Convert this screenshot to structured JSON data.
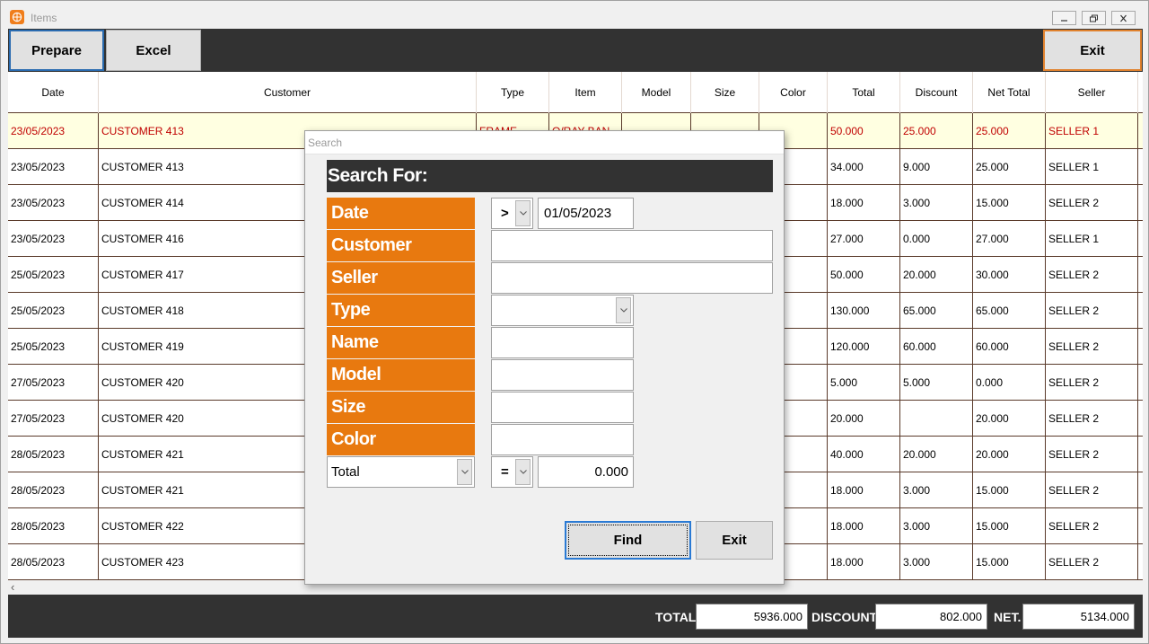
{
  "window": {
    "title": "Items"
  },
  "toolbar": {
    "prepare_label": "Prepare",
    "excel_label": "Excel",
    "exit_label": "Exit"
  },
  "table": {
    "columns": [
      "Date",
      "Customer",
      "Type",
      "Item",
      "Model",
      "Size",
      "Color",
      "Total",
      "Discount",
      "Net Total",
      "Seller"
    ],
    "rows": [
      [
        "23/05/2023",
        "CUSTOMER 413",
        "FRAME",
        "O/RAY BAN",
        "",
        "",
        "",
        "50.000",
        "25.000",
        "25.000",
        "SELLER 1"
      ],
      [
        "23/05/2023",
        "CUSTOMER 413",
        "",
        "",
        "",
        "",
        "",
        "34.000",
        "9.000",
        "25.000",
        "SELLER 1"
      ],
      [
        "23/05/2023",
        "CUSTOMER 414",
        "",
        "",
        "",
        "",
        "",
        "18.000",
        "3.000",
        "15.000",
        "SELLER 2"
      ],
      [
        "23/05/2023",
        "CUSTOMER 416",
        "",
        "",
        "",
        "",
        "",
        "27.000",
        "0.000",
        "27.000",
        "SELLER 1"
      ],
      [
        "25/05/2023",
        "CUSTOMER 417",
        "",
        "",
        "",
        "",
        "",
        "50.000",
        "20.000",
        "30.000",
        "SELLER 2"
      ],
      [
        "25/05/2023",
        "CUSTOMER 418",
        "",
        "",
        "",
        "",
        "",
        "130.000",
        "65.000",
        "65.000",
        "SELLER 2"
      ],
      [
        "25/05/2023",
        "CUSTOMER 419",
        "",
        "",
        "",
        "",
        "",
        "120.000",
        "60.000",
        "60.000",
        "SELLER 2"
      ],
      [
        "27/05/2023",
        "CUSTOMER 420",
        "",
        "",
        "",
        "",
        "",
        "5.000",
        "5.000",
        "0.000",
        "SELLER 2"
      ],
      [
        "27/05/2023",
        "CUSTOMER 420",
        "",
        "",
        "",
        "",
        "",
        "20.000",
        "",
        "20.000",
        "SELLER 2"
      ],
      [
        "28/05/2023",
        "CUSTOMER 421",
        "",
        "",
        "",
        "",
        "",
        "40.000",
        "20.000",
        "20.000",
        "SELLER 2"
      ],
      [
        "28/05/2023",
        "CUSTOMER 421",
        "",
        "",
        "",
        "",
        "",
        "18.000",
        "3.000",
        "15.000",
        "SELLER 2"
      ],
      [
        "28/05/2023",
        "CUSTOMER 422",
        "",
        "",
        "",
        "",
        "",
        "18.000",
        "3.000",
        "15.000",
        "SELLER 2"
      ],
      [
        "28/05/2023",
        "CUSTOMER 423",
        "",
        "",
        "",
        "",
        "",
        "18.000",
        "3.000",
        "15.000",
        "SELLER 2"
      ]
    ]
  },
  "footer": {
    "total_label": "TOTAL",
    "total_value": "5936.000",
    "discount_label": "DISCOUNT",
    "discount_value": "802.000",
    "net_label": "NET.",
    "net_value": "5134.000"
  },
  "search_dialog": {
    "title": "Search",
    "header": "Search For:",
    "labels": {
      "date": "Date",
      "customer": "Customer",
      "seller": "Seller",
      "type": "Type",
      "name": "Name",
      "model": "Model",
      "size": "Size",
      "color": "Color"
    },
    "date_operator": ">",
    "date_value": "01/05/2023",
    "customer_value": "",
    "seller_value": "",
    "type_value": "",
    "name_value": "",
    "model_value": "",
    "size_value": "",
    "color_value": "",
    "amount_field": "Total",
    "amount_operator": "=",
    "amount_value": "0.000",
    "find_label": "Find",
    "exit_label": "Exit"
  },
  "colors": {
    "accent_orange": "#e8790f",
    "dark_bar": "#323232",
    "selected_text": "#c00000",
    "selected_row": "#ffffe1"
  }
}
